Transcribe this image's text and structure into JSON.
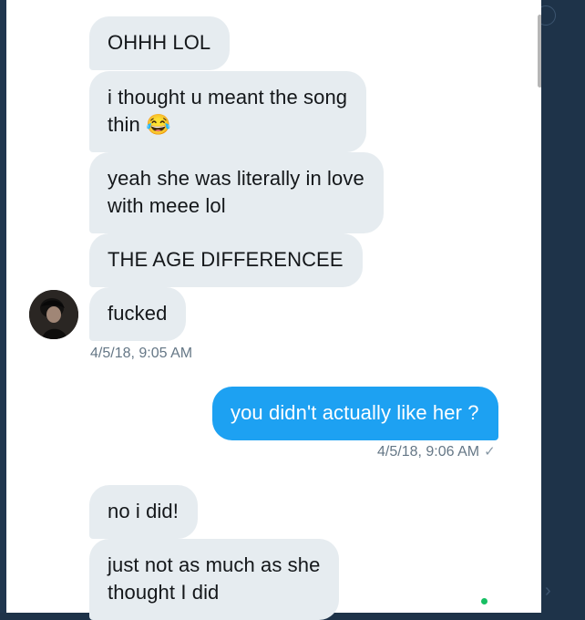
{
  "messages": [
    {
      "id": "m1",
      "dir": "in",
      "text": "OHHH LOL"
    },
    {
      "id": "m2",
      "dir": "in",
      "text": "i thought u meant the song\nthin 😂"
    },
    {
      "id": "m3",
      "dir": "in",
      "text": "yeah she was literally in love\nwith meee lol"
    },
    {
      "id": "m4",
      "dir": "in",
      "text": "THE AGE DIFFERENCEE"
    },
    {
      "id": "m5",
      "dir": "in",
      "text": "fucked"
    },
    {
      "id": "m6",
      "dir": "out",
      "text": "you didn't actually like her ?"
    },
    {
      "id": "m7",
      "dir": "in",
      "text": "no i did!"
    },
    {
      "id": "m8",
      "dir": "in",
      "text": "just not as much as she\nthought I did"
    }
  ],
  "timestamps": {
    "received": "4/5/18, 9:05 AM",
    "sent": "4/5/18, 9:06 AM",
    "read_mark": "✓"
  },
  "colors": {
    "incoming_bubble": "#e6ecf0",
    "outgoing_bubble": "#1da1f2",
    "timestamp_text": "#657786",
    "online_dot": "#17bf63",
    "side_background": "#1e3349"
  },
  "icons": {
    "avatar": "user-avatar",
    "emoji": "tears-of-joy-emoji",
    "read_receipt": "checkmark-icon"
  }
}
